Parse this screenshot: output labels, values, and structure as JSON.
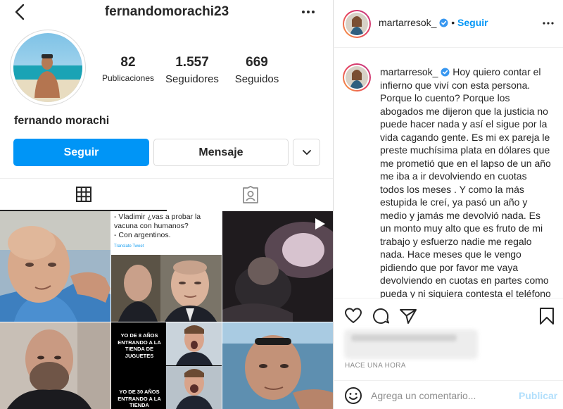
{
  "profile": {
    "username": "fernandomorachi23",
    "full_name": "fernando morachi",
    "stats": {
      "posts": {
        "value": "82",
        "label": "Publicaciones"
      },
      "followers": {
        "value": "1.557",
        "label": "Seguidores"
      },
      "following": {
        "value": "669",
        "label": "Seguidos"
      }
    },
    "buttons": {
      "follow": "Seguir",
      "message": "Mensaje"
    },
    "tabs": [
      "posts",
      "tagged"
    ]
  },
  "grid_posts": [
    {
      "text": ""
    },
    {
      "text": "- Vladimir ¿vas a probar la vacuna con humanos?\n- Con argentinos.",
      "translate": "Translate Tweet"
    },
    {
      "text": "",
      "is_video": true
    },
    {
      "text": ""
    },
    {
      "top_text": "YO DE 8 AÑOS ENTRANDO A LA TIENDA DE JUGUETES",
      "bottom_text": "YO DE 30 AÑOS ENTRANDO A LA TIENDA"
    },
    {
      "text": ""
    }
  ],
  "post": {
    "author": "martarresok_",
    "dot": "•",
    "follow": "Seguir",
    "caption": "Hoy quiero contar el infierno que viví con esta persona. Porque lo cuento? Porque los abogados me dijeron que la justicia no puede hacer nada y así el sigue por la vida cagando gente. Es mi ex pareja le preste muchísima plata en dólares que me prometió que en el lapso de un año me iba a ir devolviendo en cuotas todos los meses . Y como la más estupida le creí, ya pasó un año y medio y jamás me devolvió nada. Es un monto muy alto que es fruto de mi trabajo y esfuerzo nadie me regalo nada. Hace meses que le vengo pidiendo que por favor me vaya devolviendo en cuotas en partes como pueda y ni siquiera contesta el teléfono",
    "time": "Hace una hora",
    "comment_placeholder": "Agrega un comentario...",
    "publish": "Publicar"
  },
  "colors": {
    "accent": "#0095f6",
    "publish_disabled": "#b2dffc",
    "border": "#dbdbdb",
    "muted": "#8e8e8e"
  },
  "icons": [
    "back-arrow-icon",
    "more-icon",
    "chevron-down-icon",
    "grid-icon",
    "tagged-icon",
    "video-play-icon",
    "verified-icon",
    "heart-icon",
    "comment-icon",
    "share-icon",
    "bookmark-icon",
    "emoji-icon"
  ]
}
